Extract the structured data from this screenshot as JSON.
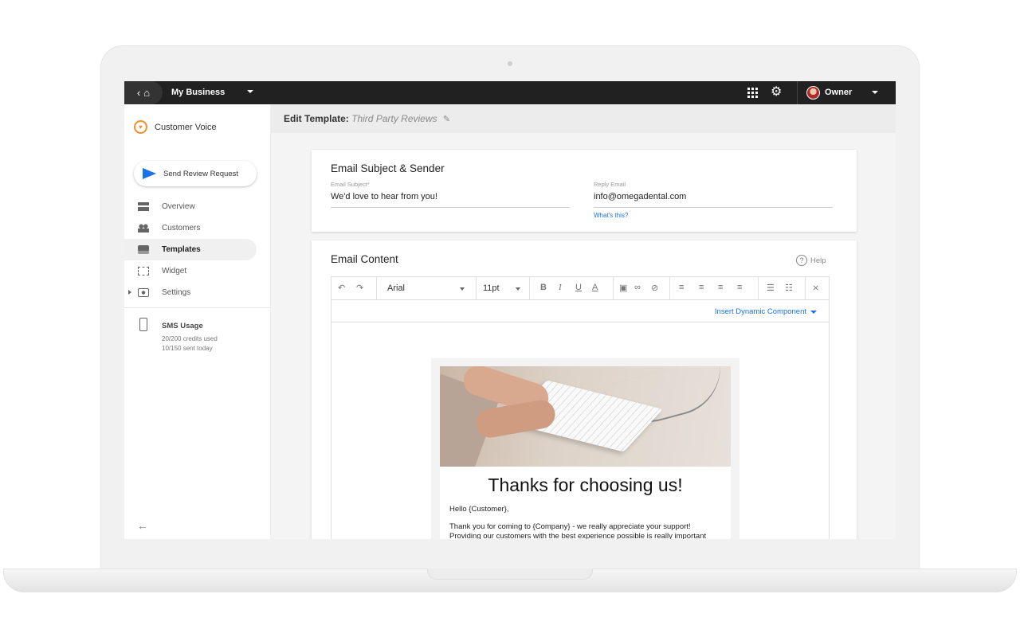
{
  "topbar": {
    "business_name": "My Business",
    "user_name": "Owner"
  },
  "sidebar": {
    "brand": "Customer Voice",
    "send_button": "Send Review Request",
    "items": [
      {
        "label": "Overview",
        "icon": "overview-icon"
      },
      {
        "label": "Customers",
        "icon": "customers-icon"
      },
      {
        "label": "Templates",
        "icon": "templates-icon",
        "active": true
      },
      {
        "label": "Widget",
        "icon": "widget-icon"
      },
      {
        "label": "Settings",
        "icon": "settings-icon"
      }
    ],
    "sms": {
      "title": "SMS Usage",
      "credits": "20/200 credits used",
      "sent": "10/150 sent today"
    }
  },
  "header": {
    "prefix": "Edit Template:",
    "template_name": "Third Party Reviews"
  },
  "subject_card": {
    "title": "Email Subject & Sender",
    "subject_label": "Email Subject*",
    "subject_value": "We'd love to hear from you!",
    "reply_label": "Reply Email",
    "reply_value": "info@omegadental.com",
    "whats_this": "What's this?"
  },
  "content_card": {
    "title": "Email Content",
    "help": "Help",
    "font": "Arial",
    "size": "11pt",
    "dynamic_component": "Insert Dynamic Component"
  },
  "email": {
    "heading": "Thanks for choosing us!",
    "greeting": "Hello {Customer},",
    "line1": "Thank you for coming to {Company} - we really appreciate your support!",
    "line2": "Providing our customers with the best experience possible is really important"
  },
  "colors": {
    "topbar": "#212121",
    "accent": "#1a73e8",
    "brand": "#f4902a"
  }
}
